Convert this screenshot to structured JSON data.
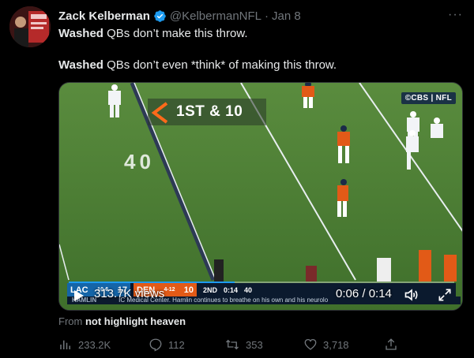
{
  "tweet": {
    "author_name": "Zack Kelberman",
    "handle": "@KelbermanNFL",
    "date": "Jan 8",
    "more_label": "···",
    "line1_bold": "Washed",
    "line1_rest": " QBs don’t make this throw.",
    "line2_bold": "Washed",
    "line2_rest": " QBs don’t even *think* of making this throw."
  },
  "video": {
    "network_badge": "©CBS | NFL",
    "down_text": "1ST & 10",
    "yard_marker": "40",
    "views": "313.7K views",
    "time": "0:06 / 0:14",
    "progress": 0.43,
    "scorebug": {
      "away_team": "LAC",
      "away_score": "17",
      "away_record": "10-6",
      "home_team": "DEN",
      "home_score": "10",
      "home_record": "4-12",
      "quarter": "2ND",
      "clock": "0:14",
      "play_clock": "40",
      "ticker_label": "HAMLIN",
      "ticker_text": "IC Medical Center. Hamlin continues to breathe on his own and his neurolo"
    }
  },
  "source": {
    "from_label": "From",
    "source_name": "not highlight heaven"
  },
  "actions": {
    "views": "233.2K",
    "replies": "112",
    "retweets": "353",
    "likes": "3,718"
  },
  "colors": {
    "background": "#000000",
    "text_primary": "#e7e9ea",
    "text_secondary": "#71767b",
    "verified": "#1d9bf0",
    "field": "#4a7a34",
    "broncos_orange": "#e25a17",
    "chargers_blue": "#1565a8"
  }
}
